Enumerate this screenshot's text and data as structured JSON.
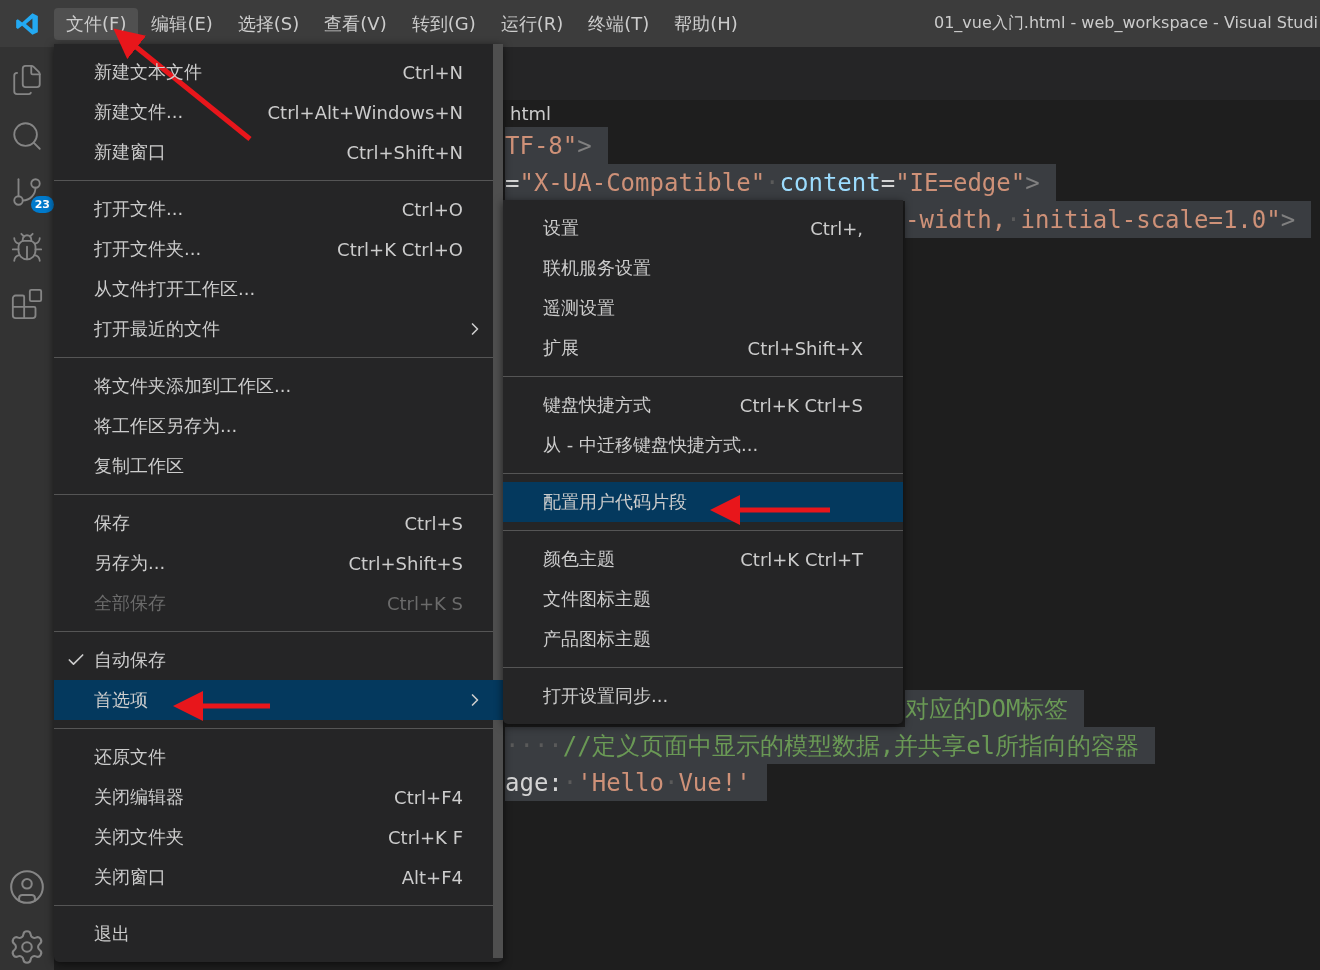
{
  "title_bar": {
    "menus": [
      {
        "label": "文件(F)",
        "selected": true
      },
      {
        "label": "编辑(E)",
        "selected": false
      },
      {
        "label": "选择(S)",
        "selected": false
      },
      {
        "label": "查看(V)",
        "selected": false
      },
      {
        "label": "转到(G)",
        "selected": false
      },
      {
        "label": "运行(R)",
        "selected": false
      },
      {
        "label": "终端(T)",
        "selected": false
      },
      {
        "label": "帮助(H)",
        "selected": false
      }
    ],
    "title": "01_vue入门.html - web_workspace - Visual Studi"
  },
  "activity_bar": {
    "source_control_badge": "23"
  },
  "breadcrumb": "html",
  "code_lines": [
    [
      {
        "text": "TF-8\"",
        "kind": "string"
      },
      {
        "text": ">",
        "kind": "punct"
      }
    ],
    [
      {
        "text": "=",
        "kind": "plain"
      },
      {
        "text": "\"X-UA-Compatible\"",
        "kind": "string"
      },
      {
        "text": "·",
        "kind": "space"
      },
      {
        "text": "content",
        "kind": "attr"
      },
      {
        "text": "=",
        "kind": "plain"
      },
      {
        "text": "\"IE=edge\"",
        "kind": "string"
      },
      {
        "text": ">",
        "kind": "punct"
      }
    ],
    [
      {
        "text": "-width,",
        "kind": "string"
      },
      {
        "text": "·",
        "kind": "space"
      },
      {
        "text": "initial-scale=1.0\"",
        "kind": "string"
      },
      {
        "text": ">",
        "kind": "punct"
      }
    ],
    [
      {
        "text": "对应的DOM标签",
        "kind": "comment"
      }
    ],
    [
      {
        "text": "····",
        "kind": "space"
      },
      {
        "text": "//定义页面中显示的模型数据,并共享el所指向的容器",
        "kind": "comment"
      }
    ],
    [
      {
        "text": "age:",
        "kind": "plain"
      },
      {
        "text": "·",
        "kind": "space"
      },
      {
        "text": "'Hello",
        "kind": "string"
      },
      {
        "text": "·",
        "kind": "space"
      },
      {
        "text": "Vue!'",
        "kind": "string"
      }
    ]
  ],
  "file_menu": {
    "groups": [
      [
        {
          "label": "新建文本文件",
          "shortcut": "Ctrl+N",
          "checked": false,
          "disabled": false,
          "selected": false,
          "submenu": false
        },
        {
          "label": "新建文件...",
          "shortcut": "Ctrl+Alt+Windows+N",
          "checked": false,
          "disabled": false,
          "selected": false,
          "submenu": false
        },
        {
          "label": "新建窗口",
          "shortcut": "Ctrl+Shift+N",
          "checked": false,
          "disabled": false,
          "selected": false,
          "submenu": false
        }
      ],
      [
        {
          "label": "打开文件...",
          "shortcut": "Ctrl+O",
          "checked": false,
          "disabled": false,
          "selected": false,
          "submenu": false
        },
        {
          "label": "打开文件夹...",
          "shortcut": "Ctrl+K Ctrl+O",
          "checked": false,
          "disabled": false,
          "selected": false,
          "submenu": false
        },
        {
          "label": "从文件打开工作区...",
          "checked": false,
          "disabled": false,
          "selected": false,
          "submenu": false
        },
        {
          "label": "打开最近的文件",
          "checked": false,
          "disabled": false,
          "selected": false,
          "submenu": true
        }
      ],
      [
        {
          "label": "将文件夹添加到工作区...",
          "checked": false,
          "disabled": false,
          "selected": false,
          "submenu": false
        },
        {
          "label": "将工作区另存为...",
          "checked": false,
          "disabled": false,
          "selected": false,
          "submenu": false
        },
        {
          "label": "复制工作区",
          "checked": false,
          "disabled": false,
          "selected": false,
          "submenu": false
        }
      ],
      [
        {
          "label": "保存",
          "shortcut": "Ctrl+S",
          "checked": false,
          "disabled": false,
          "selected": false,
          "submenu": false
        },
        {
          "label": "另存为...",
          "shortcut": "Ctrl+Shift+S",
          "checked": false,
          "disabled": false,
          "selected": false,
          "submenu": false
        },
        {
          "label": "全部保存",
          "shortcut": "Ctrl+K S",
          "checked": false,
          "disabled": true,
          "selected": false,
          "submenu": false
        }
      ],
      [
        {
          "label": "自动保存",
          "checked": true,
          "disabled": false,
          "selected": false,
          "submenu": false
        },
        {
          "label": "首选项",
          "checked": false,
          "disabled": false,
          "selected": true,
          "submenu": true
        }
      ],
      [
        {
          "label": "还原文件",
          "checked": false,
          "disabled": false,
          "selected": false,
          "submenu": false
        },
        {
          "label": "关闭编辑器",
          "shortcut": "Ctrl+F4",
          "checked": false,
          "disabled": false,
          "selected": false,
          "submenu": false
        },
        {
          "label": "关闭文件夹",
          "shortcut": "Ctrl+K F",
          "checked": false,
          "disabled": false,
          "selected": false,
          "submenu": false
        },
        {
          "label": "关闭窗口",
          "shortcut": "Alt+F4",
          "checked": false,
          "disabled": false,
          "selected": false,
          "submenu": false
        }
      ],
      [
        {
          "label": "退出",
          "checked": false,
          "disabled": false,
          "selected": false,
          "submenu": false
        }
      ]
    ]
  },
  "preferences_menu": {
    "groups": [
      [
        {
          "label": "设置",
          "shortcut": "Ctrl+,",
          "selected": false
        },
        {
          "label": "联机服务设置",
          "selected": false
        },
        {
          "label": "遥测设置",
          "selected": false
        },
        {
          "label": "扩展",
          "shortcut": "Ctrl+Shift+X",
          "selected": false
        }
      ],
      [
        {
          "label": "键盘快捷方式",
          "shortcut": "Ctrl+K Ctrl+S",
          "selected": false
        },
        {
          "label": "从 - 中迁移键盘快捷方式...",
          "selected": false
        }
      ],
      [
        {
          "label": "配置用户代码片段",
          "selected": true
        }
      ],
      [
        {
          "label": "颜色主题",
          "shortcut": "Ctrl+K Ctrl+T",
          "selected": false
        },
        {
          "label": "文件图标主题",
          "selected": false
        },
        {
          "label": "产品图标主题",
          "selected": false
        }
      ],
      [
        {
          "label": "打开设置同步...",
          "selected": false
        }
      ]
    ]
  }
}
